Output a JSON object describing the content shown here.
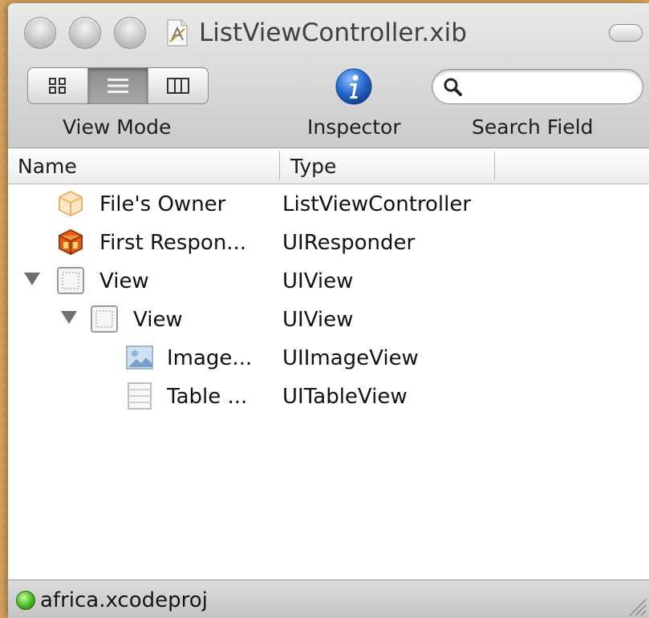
{
  "window": {
    "title": "ListViewController.xib"
  },
  "toolbar": {
    "view_mode_label": "View Mode",
    "inspector_label": "Inspector",
    "search_label": "Search Field",
    "search_placeholder": "",
    "view_modes": [
      {
        "icon": "icon-grid-icon",
        "selected": false
      },
      {
        "icon": "list-icon",
        "selected": true
      },
      {
        "icon": "columns-icon",
        "selected": false
      }
    ],
    "inspector_icon": "info-icon"
  },
  "table": {
    "columns": [
      "Name",
      "Type"
    ],
    "rows": [
      {
        "name": "File's Owner",
        "type": "ListViewController",
        "icon": "cube-outline-icon",
        "indent": 0,
        "expanded": null
      },
      {
        "name": "First Respon...",
        "type": "UIResponder",
        "icon": "responder-cube-icon",
        "indent": 0,
        "expanded": null
      },
      {
        "name": "View",
        "type": "UIView",
        "icon": "view-icon",
        "indent": 0,
        "expanded": true
      },
      {
        "name": "View",
        "type": "UIView",
        "icon": "view-icon",
        "indent": 1,
        "expanded": true
      },
      {
        "name": "Image...",
        "type": "UIImageView",
        "icon": "image-view-icon",
        "indent": 2,
        "expanded": null
      },
      {
        "name": "Table ...",
        "type": "UITableView",
        "icon": "table-view-icon",
        "indent": 2,
        "expanded": null
      }
    ]
  },
  "status": {
    "project": "africa.xcodeproj",
    "indicator_color": "#3cae1c"
  },
  "colors": {
    "inspector_blue": "#2f6fd0",
    "desktop": "#d9a45e"
  }
}
